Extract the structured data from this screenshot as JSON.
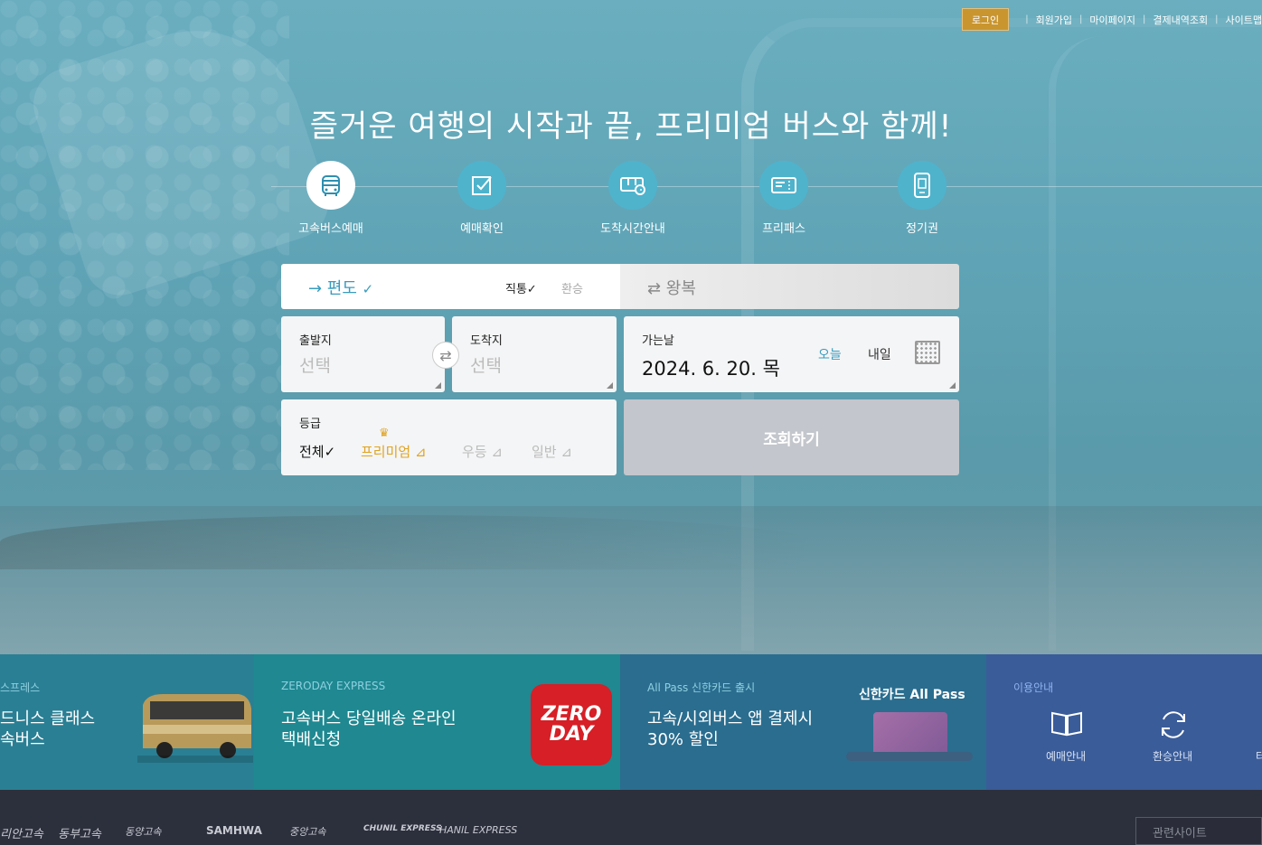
{
  "topnav": {
    "login": "로그인",
    "links": [
      "회원가입",
      "마이페이지",
      "결제내역조회",
      "사이트맵"
    ]
  },
  "headline": "즐거운 여행의 시작과 끝, 프리미엄 버스와 함께!",
  "menu": [
    {
      "label": "고속버스예매",
      "icon": "bus-icon"
    },
    {
      "label": "예매확인",
      "icon": "checkbox-icon"
    },
    {
      "label": "도착시간안내",
      "icon": "bus-clock-icon"
    },
    {
      "label": "프리패스",
      "icon": "ticket-icon"
    },
    {
      "label": "정기권",
      "icon": "pass-card-icon"
    }
  ],
  "trip": {
    "oneway": "→ 편도",
    "oneway_check": "✓",
    "direct": "직통✓",
    "transfer": "환승",
    "roundtrip": "⇄ 왕복"
  },
  "departure": {
    "label": "출발지",
    "value": "선택"
  },
  "arrival": {
    "label": "도착지",
    "value": "선택"
  },
  "date": {
    "label": "가는날",
    "value": "2024. 6. 20. 목",
    "today": "오늘",
    "tomorrow": "내일"
  },
  "grade": {
    "label": "등급",
    "options": [
      "전체✓",
      "프리미엄",
      "우등",
      "일반"
    ]
  },
  "search_button": "조회하기",
  "banners": {
    "b1": {
      "small": "스프레스",
      "title_line1": "드니스 클래스",
      "title_line2": "속버스"
    },
    "b2": {
      "small": "ZERODAY EXPRESS",
      "title_line1": "고속버스 당일배송 온라인",
      "title_line2": "택배신청",
      "logo_line1": "ZERO",
      "logo_line2": "DAY"
    },
    "b3": {
      "small": "All Pass 신한카드 출시",
      "title_line1": "고속/시외버스 앱 결제시",
      "title_line2": "30% 할인",
      "card_title": "신한카드 All Pass"
    },
    "b4": {
      "small": "이용안내",
      "items": [
        "예매안내",
        "환승안내",
        "터"
      ]
    }
  },
  "footer": {
    "logos": [
      "리안고속",
      "동부고속",
      "동양고속",
      "SAMHWA",
      "중앙고속",
      "CHUNIL EXPRESS",
      "HANIL EXPRESS"
    ],
    "related": "관련사이트"
  },
  "colors": {
    "accent": "#3a9bbd",
    "premium": "#e0a321",
    "login": "#c9952f"
  }
}
